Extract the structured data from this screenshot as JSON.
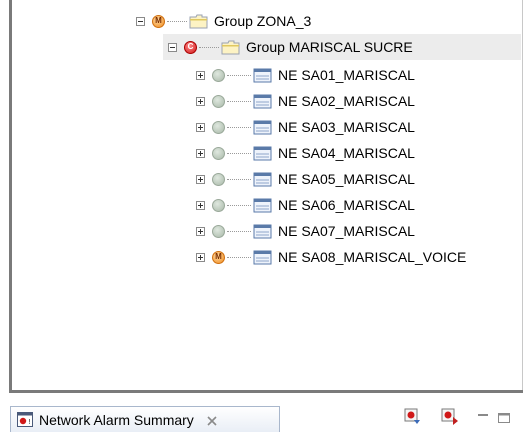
{
  "tree": {
    "items": [
      {
        "label": "Group ZONA_3",
        "type": "group",
        "status": "M",
        "status_color": "orange",
        "expander": "minus"
      },
      {
        "label": "Group MARISCAL SUCRE",
        "type": "group",
        "status": "C",
        "status_color": "red",
        "expander": "minus"
      },
      {
        "label": "NE SA01_MARISCAL",
        "type": "ne",
        "status": "",
        "status_color": "gray",
        "expander": "plus"
      },
      {
        "label": "NE SA02_MARISCAL",
        "type": "ne",
        "status": "",
        "status_color": "gray",
        "expander": "plus"
      },
      {
        "label": "NE SA03_MARISCAL",
        "type": "ne",
        "status": "",
        "status_color": "gray",
        "expander": "plus"
      },
      {
        "label": "NE SA04_MARISCAL",
        "type": "ne",
        "status": "",
        "status_color": "gray",
        "expander": "plus"
      },
      {
        "label": "NE SA05_MARISCAL",
        "type": "ne",
        "status": "",
        "status_color": "gray",
        "expander": "plus"
      },
      {
        "label": "NE SA06_MARISCAL",
        "type": "ne",
        "status": "",
        "status_color": "gray",
        "expander": "plus"
      },
      {
        "label": "NE SA07_MARISCAL",
        "type": "ne",
        "status": "",
        "status_color": "gray",
        "expander": "plus"
      },
      {
        "label": "NE SA08_MARISCAL_VOICE",
        "type": "ne",
        "status": "M",
        "status_color": "orange",
        "expander": "plus"
      }
    ]
  },
  "bottom_panel": {
    "tab_label": "Network Alarm Summary",
    "tab_icon": "alarm-summary-icon",
    "close_icon": "close-icon",
    "toolbar_icons": [
      "alarm-navigate-icon",
      "alarm-filter-icon"
    ],
    "minimize_icon": "minimize-icon",
    "maximize_icon": "maximize-icon"
  },
  "colors": {
    "status_orange": "#f08c20",
    "status_red": "#d01818",
    "status_gray": "#a9b9a9",
    "selection_bg": "#ececec"
  }
}
